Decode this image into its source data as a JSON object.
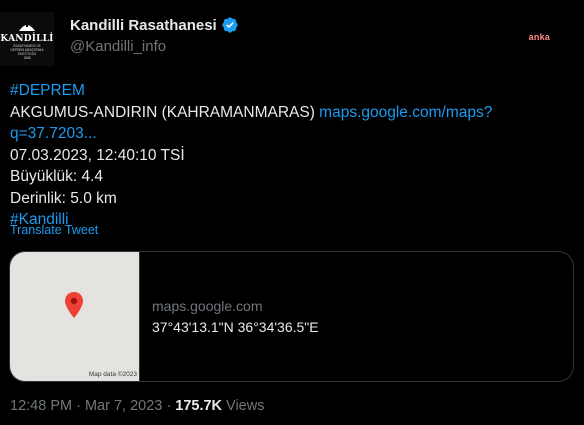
{
  "author": {
    "display_name": "Kandilli Rasathanesi",
    "handle": "@Kandilli_info",
    "avatar_brand": "KANDİLLİ",
    "avatar_subtext": "RASATHANESİ VE\nDEPREM ARAŞTIRMA\nENSTİTÜSÜ\n1868",
    "verified_icon": "verified-badge-icon"
  },
  "watermark": "anka",
  "tweet": {
    "hashtag1": "#DEPREM",
    "location": "AKGUMUS-ANDIRIN (KAHRAMANMARAS)",
    "link_part1": "maps.google.com/maps?",
    "link_part2": "q=37.7203...",
    "datetime": "07.03.2023, 12:40:10 TSİ",
    "magnitude": "Büyüklük: 4.4",
    "depth": "Derinlik: 5.0 km",
    "hashtag2": "#Kandilli"
  },
  "translate_label": "Translate Tweet",
  "card": {
    "domain": "maps.google.com",
    "title": "37°43'13.1\"N 36°34'36.5\"E",
    "map_credit": "Map data ©2023",
    "pin_icon": "map-pin-icon"
  },
  "meta": {
    "time": "12:48 PM",
    "separator1": " · ",
    "date": "Mar 7, 2023",
    "separator2": " · ",
    "views_count": "175.7K",
    "views_label": " Views"
  },
  "colors": {
    "background": "#000000",
    "text": "#e7e9ea",
    "muted": "#71767b",
    "link": "#1d9bf0",
    "border": "#2f3336",
    "pin": "#ea4335"
  }
}
